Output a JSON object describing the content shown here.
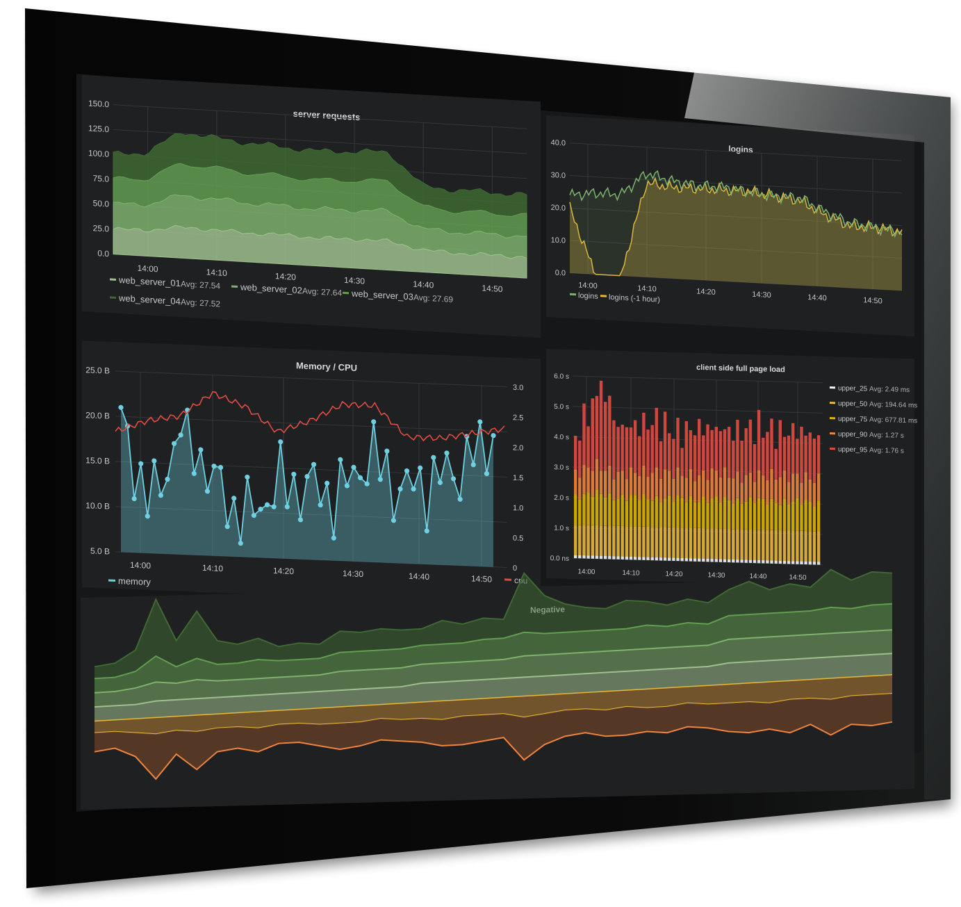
{
  "colors": {
    "frame": "#070707",
    "screen": "#161719",
    "panel": "#1f2022",
    "grid": "#34363a",
    "text": "#c8c8c8",
    "green_1": "#9fc08e",
    "green_2": "#7eb26d",
    "green_3": "#629e51",
    "green_4": "#3f6833",
    "logins": "#7eb26d",
    "logins_prev": "#eab839",
    "memory": "#6ed0e0",
    "cpu": "#e24d42",
    "upper_25": "#f5f5f5",
    "upper_50": "#eab839",
    "upper_75": "#e0b400",
    "upper_90": "#ef843c",
    "upper_95": "#e24d42",
    "neg_orange": "#ef843c",
    "neg_yellow": "#eab839"
  },
  "panels": {
    "server_requests": {
      "title": "server requests",
      "legend": [
        {
          "name": "web_server_01",
          "avg": "Avg: 27.54",
          "color": "#9fc08e"
        },
        {
          "name": "web_server_02",
          "avg": "Avg: 27.64",
          "color": "#7eb26d"
        },
        {
          "name": "web_server_03",
          "avg": "Avg: 27.69",
          "color": "#629e51"
        },
        {
          "name": "web_server_04",
          "avg": "Avg: 27.52",
          "color": "#3f6833"
        }
      ]
    },
    "logins": {
      "title": "logins",
      "legend": [
        {
          "name": "logins",
          "color": "#7eb26d"
        },
        {
          "name": "logins (-1 hour)",
          "color": "#eab839"
        }
      ]
    },
    "memory_cpu": {
      "title": "Memory / CPU",
      "legend": [
        {
          "name": "memory",
          "color": "#6ed0e0"
        },
        {
          "name": "cpu",
          "color": "#e24d42"
        }
      ]
    },
    "page_load": {
      "title": "client side full page load",
      "legend": [
        {
          "name": "upper_25",
          "avg": "Avg: 2.49 ms",
          "color": "#f5f5f5"
        },
        {
          "name": "upper_50",
          "avg": "Avg: 194.64 ms",
          "color": "#eab839"
        },
        {
          "name": "upper_75",
          "avg": "Avg: 677.81 ms",
          "color": "#e0b400"
        },
        {
          "name": "upper_90",
          "avg": "Avg: 1.27 s",
          "color": "#ef843c"
        },
        {
          "name": "upper_95",
          "avg": "Avg: 1.76 s",
          "color": "#e24d42"
        }
      ]
    },
    "negative": {
      "title": "Negative"
    }
  },
  "chart_data": [
    {
      "type": "area",
      "title": "server requests",
      "stacked": true,
      "x": [
        "13:55",
        "14:00",
        "14:05",
        "14:10",
        "14:15",
        "14:20",
        "14:25",
        "14:30",
        "14:35",
        "14:40",
        "14:45",
        "14:50",
        "14:55"
      ],
      "x_ticks": [
        "14:00",
        "14:10",
        "14:20",
        "14:30",
        "14:40",
        "14:50"
      ],
      "y_ticks": [
        "150.0",
        "125.0",
        "100.0",
        "75.0",
        "50.0",
        "25.0",
        "0.0"
      ],
      "ylim": [
        0,
        150
      ],
      "grid": true,
      "legend_position": "bottom",
      "series": [
        {
          "name": "web_server_01",
          "values": [
            25,
            26,
            31,
            30,
            29,
            29,
            28,
            29,
            29,
            22,
            21,
            21,
            21
          ]
        },
        {
          "name": "web_server_02",
          "values": [
            25,
            26,
            32,
            31,
            30,
            29,
            29,
            29,
            30,
            21,
            21,
            21,
            21
          ]
        },
        {
          "name": "web_server_03",
          "values": [
            25,
            26,
            32,
            31,
            30,
            30,
            29,
            30,
            30,
            22,
            21,
            21,
            21
          ]
        },
        {
          "name": "web_server_04",
          "values": [
            25,
            26,
            32,
            30,
            30,
            29,
            29,
            29,
            29,
            21,
            21,
            21,
            20
          ]
        }
      ]
    },
    {
      "type": "line",
      "title": "logins",
      "x": [
        "13:55",
        "14:00",
        "14:03",
        "14:05",
        "14:10",
        "14:15",
        "14:20",
        "14:25",
        "14:30",
        "14:35",
        "14:40",
        "14:45",
        "14:50",
        "14:55"
      ],
      "x_ticks": [
        "14:00",
        "14:10",
        "14:20",
        "14:30",
        "14:40",
        "14:50"
      ],
      "y_ticks": [
        "40.0",
        "30.0",
        "20.0",
        "10.0",
        "0.0"
      ],
      "ylim": [
        0,
        40
      ],
      "grid": true,
      "legend_position": "bottom",
      "series": [
        {
          "name": "logins",
          "values": [
            24,
            25,
            25,
            32,
            30,
            29,
            29,
            28,
            27,
            27,
            23,
            20,
            19,
            18
          ]
        },
        {
          "name": "logins (-1 hour)",
          "values": [
            20,
            0,
            0,
            29,
            28,
            28,
            28,
            28,
            27,
            26,
            22,
            19,
            19,
            18
          ]
        }
      ]
    },
    {
      "type": "line",
      "title": "Memory / CPU",
      "x": [
        "13:55",
        "14:00",
        "14:05",
        "14:10",
        "14:15",
        "14:20",
        "14:25",
        "14:30",
        "14:35",
        "14:40",
        "14:45",
        "14:50",
        "14:55"
      ],
      "x_ticks": [
        "14:00",
        "14:10",
        "14:20",
        "14:30",
        "14:40",
        "14:50"
      ],
      "y_ticks": [
        "25.0 B",
        "20.0 B",
        "15.0 B",
        "10.0 B",
        "5.0 B"
      ],
      "y2_ticks": [
        "3.0",
        "2.5",
        "2.0",
        "1.5",
        "1.0",
        "0.5",
        "0"
      ],
      "ylim": [
        5,
        25
      ],
      "y2lim": [
        0,
        3
      ],
      "grid": true,
      "legend_position": "bottom",
      "series": [
        {
          "name": "memory",
          "axis": "left",
          "values": [
            19,
            10,
            20,
            13,
            9,
            13,
            13,
            12,
            17,
            13,
            14,
            16,
            20
          ]
        },
        {
          "name": "cpu",
          "axis": "right",
          "values": [
            2.0,
            2.2,
            2.3,
            2.7,
            2.5,
            2.1,
            2.3,
            2.6,
            2.6,
            2.1,
            2.1,
            2.2,
            2.3
          ]
        }
      ]
    },
    {
      "type": "bar",
      "title": "client side full page load",
      "stacked": true,
      "x": [
        "13:55",
        "14:00",
        "14:05",
        "14:10",
        "14:15",
        "14:20",
        "14:25",
        "14:30",
        "14:35",
        "14:40",
        "14:45",
        "14:50",
        "14:55"
      ],
      "x_ticks": [
        "14:00",
        "14:10",
        "14:20",
        "14:30",
        "14:40",
        "14:50"
      ],
      "y_ticks": [
        "6.0 s",
        "5.0 s",
        "4.0 s",
        "3.0 s",
        "2.0 s",
        "1.0 s",
        "0.0 ns"
      ],
      "ylim": [
        0,
        6
      ],
      "grid": true,
      "legend_position": "right",
      "series": [
        {
          "name": "upper_25",
          "values": [
            0.1,
            0.1,
            0.1,
            0.1,
            0.1,
            0.1,
            0.1,
            0.1,
            0.1,
            0.1,
            0.1,
            0.1,
            0.1
          ]
        },
        {
          "name": "upper_50",
          "values": [
            1.0,
            1.0,
            1.0,
            1.0,
            1.0,
            1.0,
            1.0,
            1.0,
            1.0,
            1.0,
            1.0,
            1.0,
            1.0
          ]
        },
        {
          "name": "upper_75",
          "values": [
            0.9,
            1.1,
            0.9,
            1.0,
            0.9,
            1.0,
            0.9,
            1.0,
            0.9,
            1.0,
            0.9,
            1.0,
            0.9
          ]
        },
        {
          "name": "upper_90",
          "values": [
            0.8,
            0.9,
            0.8,
            0.8,
            0.9,
            0.8,
            0.8,
            0.9,
            0.8,
            0.8,
            0.9,
            0.8,
            0.8
          ]
        },
        {
          "name": "upper_95",
          "values": [
            1.2,
            2.2,
            1.6,
            1.5,
            1.7,
            1.3,
            1.6,
            1.4,
            1.5,
            1.6,
            1.4,
            1.5,
            1.4
          ]
        }
      ]
    },
    {
      "type": "area",
      "title": "Negative",
      "stacked": true,
      "grid": false,
      "x": [
        0,
        1,
        2,
        3,
        4,
        5,
        6,
        7,
        8,
        9,
        10,
        11,
        12,
        13,
        14,
        15,
        16,
        17,
        18,
        19,
        20,
        21,
        22,
        23,
        24,
        25,
        26,
        27,
        28,
        29,
        30,
        31,
        32,
        33,
        34,
        35,
        36,
        37,
        38,
        39
      ],
      "series_positive": [
        {
          "name": "green_4",
          "values": [
            0.5,
            0.6,
            0.9,
            2.4,
            1.1,
            2.0,
            1.0,
            0.8,
            0.9,
            0.6,
            0.7,
            0.6,
            0.9,
            0.8,
            0.9,
            0.8,
            0.7,
            1.0,
            0.8,
            0.9,
            0.8,
            2.5,
            1.6,
            1.2,
            1.0,
            0.9,
            1.2,
            1.0,
            0.9,
            1.0,
            0.9,
            1.1,
            1.4,
            1.0,
            1.2,
            1.0,
            1.6,
            1.2,
            1.4,
            1.3
          ]
        },
        {
          "name": "green_3",
          "values": [
            0.6,
            0.6,
            0.7,
            1.1,
            0.7,
            0.9,
            0.7,
            0.7,
            0.8,
            0.7,
            0.7,
            0.7,
            0.8,
            0.8,
            0.8,
            0.8,
            0.8,
            0.8,
            0.8,
            0.9,
            0.9,
            1.0,
            0.9,
            0.9,
            0.9,
            0.9,
            0.9,
            1.0,
            0.9,
            1.0,
            0.9,
            1.0,
            1.0,
            1.0,
            1.0,
            1.0,
            1.1,
            1.0,
            1.1,
            1.1
          ]
        },
        {
          "name": "green_2",
          "values": [
            0.6,
            0.6,
            0.7,
            0.8,
            0.7,
            0.8,
            0.7,
            0.7,
            0.7,
            0.7,
            0.7,
            0.7,
            0.8,
            0.8,
            0.8,
            0.8,
            0.8,
            0.8,
            0.8,
            0.8,
            0.8,
            0.9,
            0.9,
            0.9,
            0.9,
            0.9,
            0.9,
            0.9,
            0.9,
            0.9,
            0.9,
            1.0,
            1.0,
            1.0,
            1.0,
            1.0,
            1.0,
            1.0,
            1.0,
            1.0
          ]
        },
        {
          "name": "green_1",
          "values": [
            0.6,
            0.6,
            0.6,
            0.7,
            0.7,
            0.7,
            0.7,
            0.7,
            0.7,
            0.7,
            0.7,
            0.7,
            0.7,
            0.7,
            0.7,
            0.7,
            0.8,
            0.8,
            0.8,
            0.8,
            0.8,
            0.8,
            0.8,
            0.8,
            0.8,
            0.8,
            0.8,
            0.8,
            0.8,
            0.8,
            0.8,
            0.9,
            0.9,
            0.9,
            0.9,
            0.9,
            0.9,
            0.9,
            0.9,
            0.9
          ]
        }
      ],
      "series_negative": [
        {
          "name": "neg_yellow",
          "values": [
            -0.5,
            -0.5,
            -0.6,
            -0.7,
            -0.6,
            -0.7,
            -0.6,
            -0.6,
            -0.7,
            -0.6,
            -0.6,
            -0.7,
            -0.7,
            -0.7,
            -0.6,
            -0.7,
            -0.7,
            -0.8,
            -0.7,
            -0.7,
            -0.7,
            -0.9,
            -0.8,
            -0.7,
            -0.7,
            -0.8,
            -0.7,
            -0.8,
            -0.8,
            -0.7,
            -0.8,
            -0.8,
            -0.8,
            -0.9,
            -0.8,
            -0.8,
            -0.9,
            -0.8,
            -0.8,
            -0.8
          ]
        },
        {
          "name": "neg_orange",
          "values": [
            -0.8,
            -0.7,
            -1.0,
            -1.9,
            -1.0,
            -1.6,
            -1.0,
            -0.9,
            -1.0,
            -0.8,
            -0.8,
            -0.9,
            -1.1,
            -1.0,
            -0.9,
            -0.9,
            -1.0,
            -1.1,
            -1.2,
            -1.1,
            -1.0,
            -1.8,
            -1.3,
            -1.1,
            -1.0,
            -1.1,
            -1.2,
            -1.0,
            -1.1,
            -1.0,
            -1.0,
            -1.2,
            -1.3,
            -1.1,
            -1.4,
            -1.1,
            -1.5,
            -1.2,
            -1.3,
            -1.2
          ]
        }
      ]
    }
  ]
}
